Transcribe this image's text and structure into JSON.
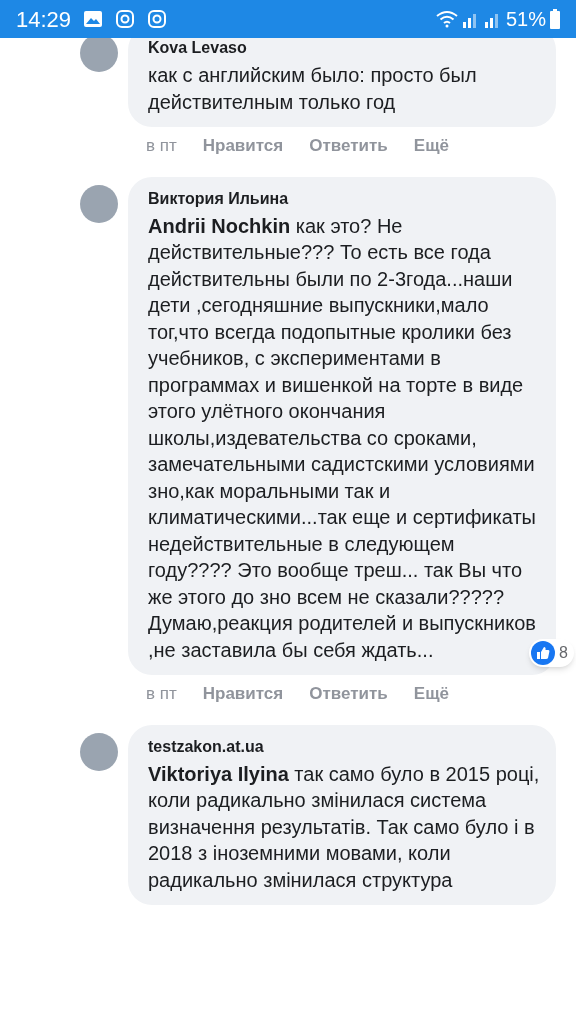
{
  "status_bar": {
    "time": "14:29",
    "battery": "51%"
  },
  "comments": [
    {
      "author": "Kova Levaso",
      "text": "как с английским было: просто был действителным только год",
      "time": "в пт",
      "actions": [
        "Нравится",
        "Ответить",
        "Ещё"
      ]
    },
    {
      "author": "Виктория Ильина",
      "text": "**Andrii Nochkin** как это? Не действительные??? То есть все года действительны были по 2-3года...наши дети ,сегодняшние выпускники,мало тог,что всегда подопытные кролики без учебников, с экспериментами в программах и вишенкой на торте в виде этого улётного окончания школы,издевательства со сроками, замечательными садистскими условиями зно,как моральными так и климатическими...так еще и сертификаты недействительные в следующем году???? Это вообще треш... так Вы что же этого до зно всем не сказали????? Думаю,реакция родителей и выпускников ,не заставила бы себя ждать...",
      "reaction_count": "8",
      "time": "в пт",
      "actions": [
        "Нравится",
        "Ответить",
        "Ещё"
      ]
    },
    {
      "author": "testzakon.at.ua",
      "text": "**Viktoriya Ilyina** так само було в 2015 році, коли радикально змінилася система визначення результатів. Так само було і в 2018 з іноземними мовами, коли радикально змінилася структура"
    }
  ]
}
